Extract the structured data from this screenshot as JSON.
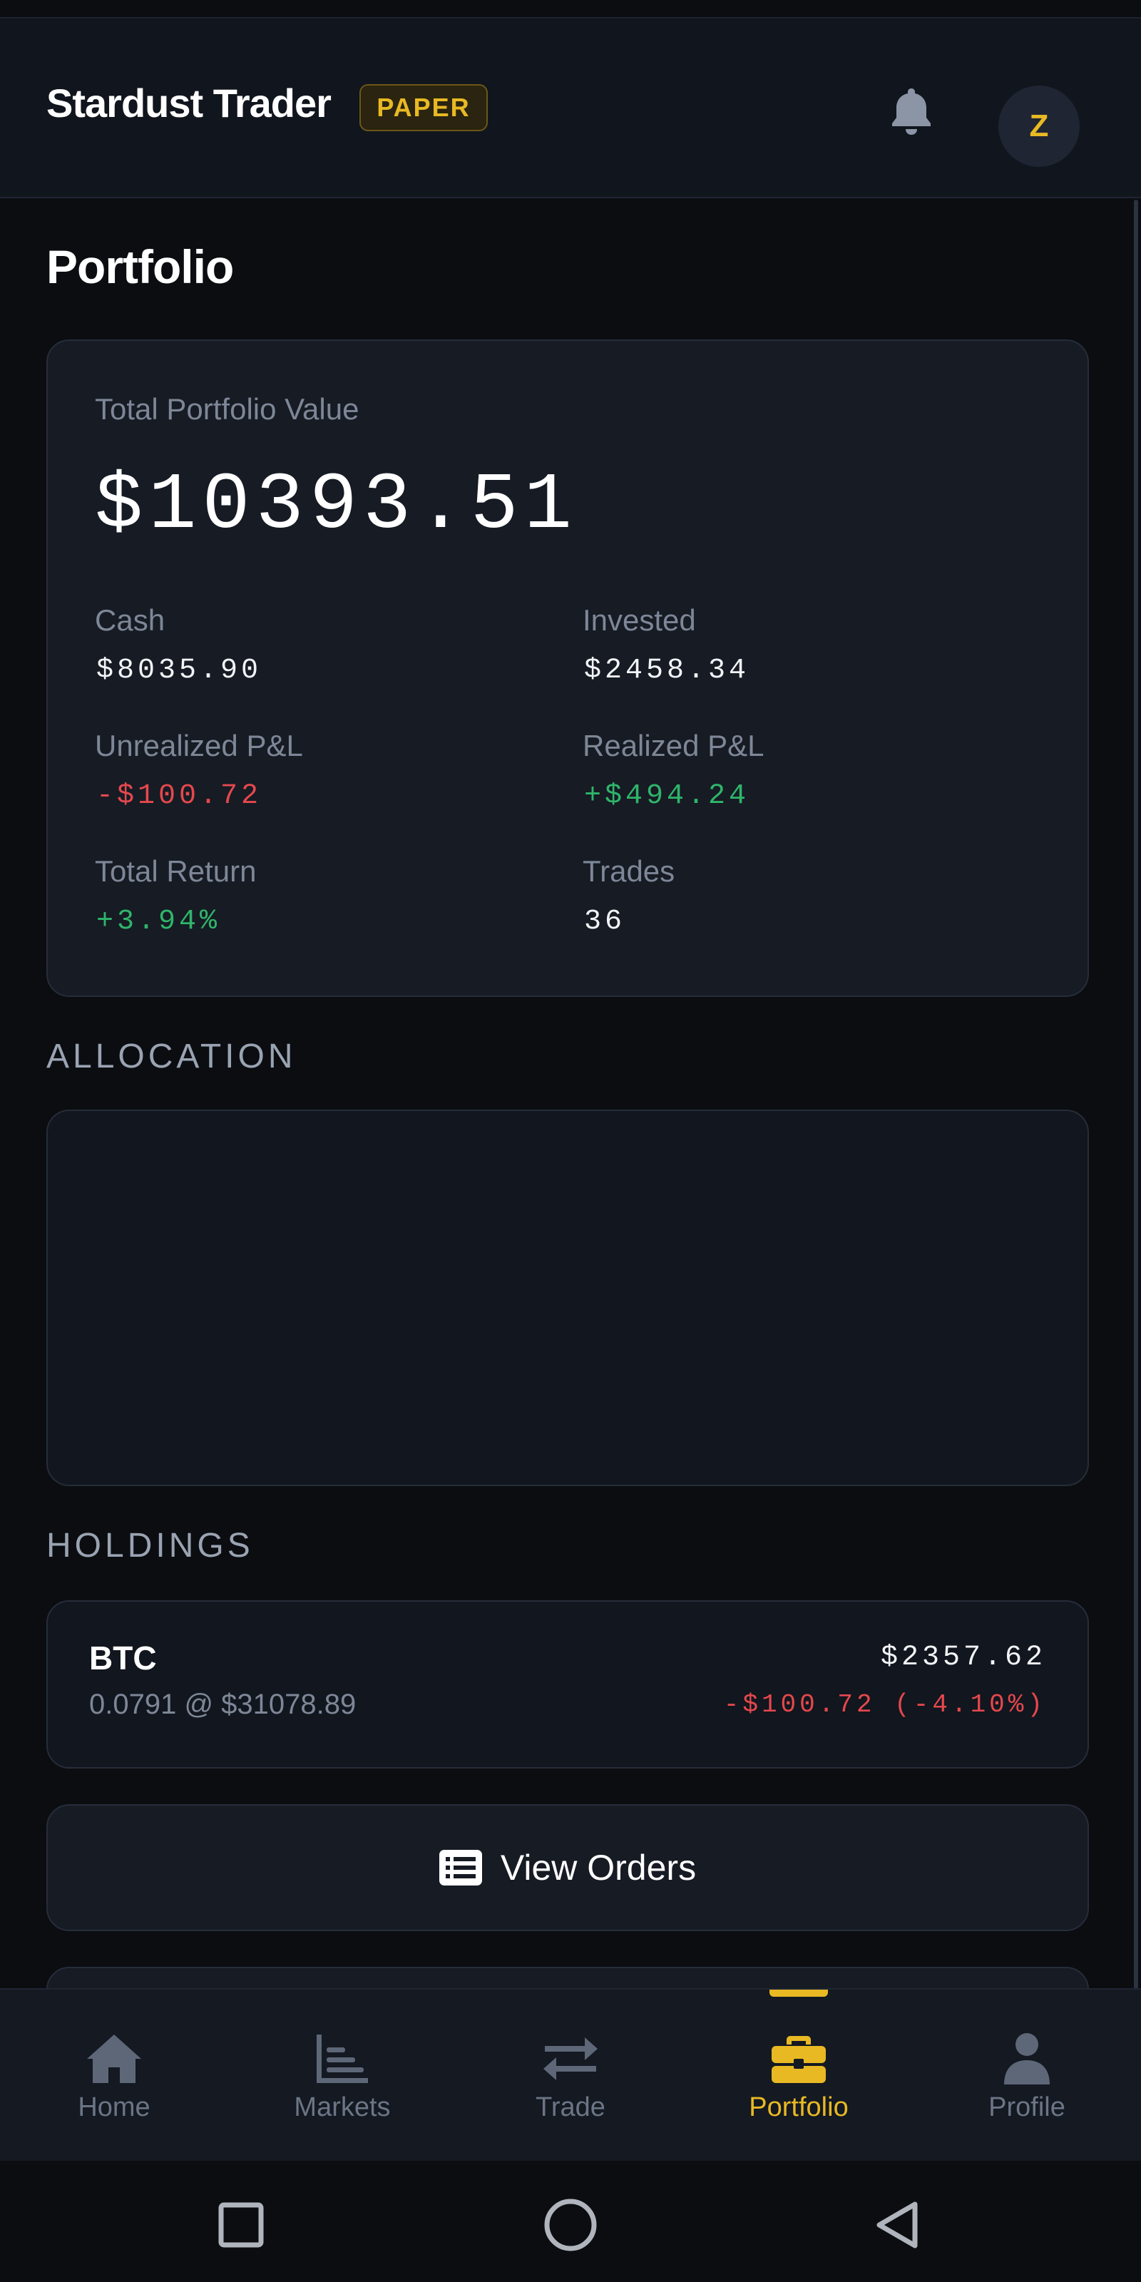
{
  "header": {
    "title": "Stardust Trader",
    "mode_badge": "PAPER",
    "avatar_initial": "Z",
    "bell_icon": "bell-icon"
  },
  "page": {
    "title": "Portfolio"
  },
  "summary": {
    "label": "Total Portfolio Value",
    "total_value": "$10393.51",
    "stats": {
      "cash_label": "Cash",
      "cash_value": "$8035.90",
      "invested_label": "Invested",
      "invested_value": "$2458.34",
      "unrealized_label": "Unrealized P&L",
      "unrealized_value": "-$100.72",
      "realized_label": "Realized P&L",
      "realized_value": "+$494.24",
      "return_label": "Total Return",
      "return_value": "+3.94%",
      "trades_label": "Trades",
      "trades_value": "36"
    }
  },
  "allocation": {
    "heading": "ALLOCATION"
  },
  "holdings": {
    "heading": "HOLDINGS",
    "items": [
      {
        "symbol": "BTC",
        "detail": "0.0791 @ $31078.89",
        "value": "$2357.62",
        "pl": "-$100.72 (-4.10%)"
      }
    ]
  },
  "actions": {
    "view_orders_label": "View Orders",
    "view_orders_icon": "list-icon"
  },
  "nav": {
    "items": [
      {
        "label": "Home",
        "icon": "home-icon"
      },
      {
        "label": "Markets",
        "icon": "bar-chart-icon"
      },
      {
        "label": "Trade",
        "icon": "swap-arrows-icon"
      },
      {
        "label": "Portfolio",
        "icon": "briefcase-icon"
      },
      {
        "label": "Profile",
        "icon": "person-icon"
      }
    ],
    "active": "Portfolio"
  },
  "system_nav": {
    "recents_icon": "square-icon",
    "home_icon": "circle-icon",
    "back_icon": "triangle-back-icon"
  },
  "colors": {
    "accent": "#e8b923",
    "negative": "#e5484d",
    "positive": "#2fb56a",
    "background": "#0b0d11",
    "card": "#161b24"
  }
}
